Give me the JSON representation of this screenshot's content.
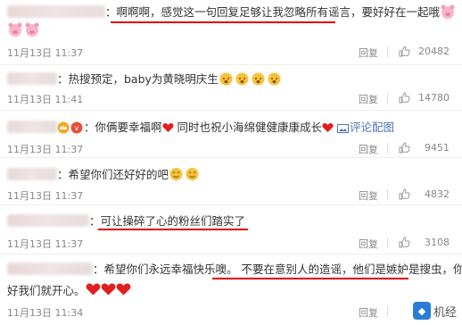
{
  "comments": [
    {
      "text": "：啊啊啊，感觉这一句回复足够让我忽略所有谣言，要好好在一起哦",
      "time": "11月13日 11:37",
      "reply": "回复",
      "likes": "20482"
    },
    {
      "text": "：热搜预定，baby为黄晓明庆生",
      "time": "11月13日 11:41",
      "reply": "回复",
      "likes": "14780"
    },
    {
      "text": "：你俩要幸福啊",
      "text2": "同时也祝小海绵健健康康成长",
      "comment_link": "评论配图",
      "time": "11月13日 11:37",
      "reply": "回复",
      "likes": "9451"
    },
    {
      "text": "：希望你们还好好的吧",
      "time": "11月13日 11:37",
      "reply": "回复",
      "likes": "4832"
    },
    {
      "text": "：可让操碎了心的粉丝们踏实了",
      "time": "11月13日 11:37",
      "reply": "回复",
      "likes": "3108"
    },
    {
      "text": "：希望你们永远幸福快乐噢。",
      "text2": "不要在意别人的造谣，他们是嫉妒是搜虫",
      "text3": "，你们",
      "line2": "好我们就开心。",
      "time": "11月13日 11:34",
      "reply": "回复"
    }
  ],
  "watermark": {
    "text": "机经",
    "logo": "Nexus"
  },
  "colors": {
    "underline": "#d00000",
    "meta": "#888888",
    "link": "#5073b5"
  }
}
